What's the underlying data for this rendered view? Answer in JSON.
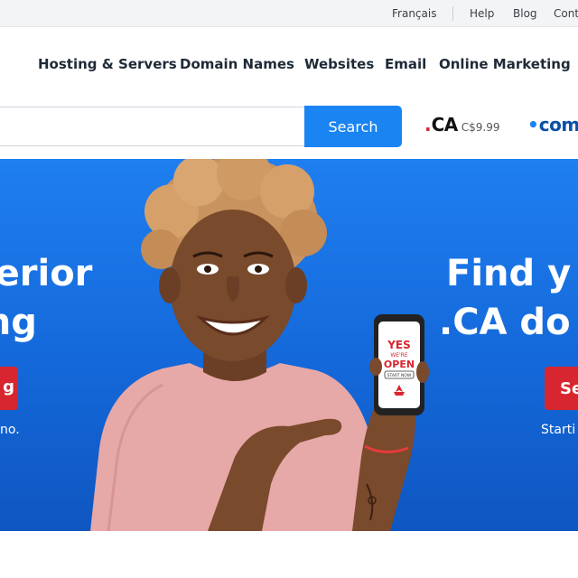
{
  "topbar": {
    "links": [
      "Français",
      "Help",
      "Blog",
      "Cont"
    ]
  },
  "nav": {
    "items": [
      "Hosting & Servers",
      "Domain Names",
      "Websites",
      "Email",
      "Online Marketing"
    ]
  },
  "search": {
    "placeholder": "",
    "button_label": "Search"
  },
  "tlds": [
    {
      "dot_color": "#d7262f",
      "name": "CA",
      "price": "C$9.99"
    },
    {
      "dot_color": "#1a84f2",
      "name": "com",
      "price": ""
    }
  ],
  "hero": {
    "left_title_line1": "perior",
    "left_title_line2": "ing",
    "left_button_label": "g",
    "left_subtext": "no.",
    "right_title_line1": "Find y",
    "right_title_line2": ".CA do",
    "right_button_label": "Se",
    "right_subtext": "Starti",
    "phone_screen": {
      "line1": "YES",
      "line2": "WE'RE",
      "line3": "OPEN",
      "line4": "START NOW"
    }
  },
  "colors": {
    "accent_blue": "#1a84f2",
    "hero_blue": "#1468d9",
    "cta_red": "#d7262f"
  }
}
